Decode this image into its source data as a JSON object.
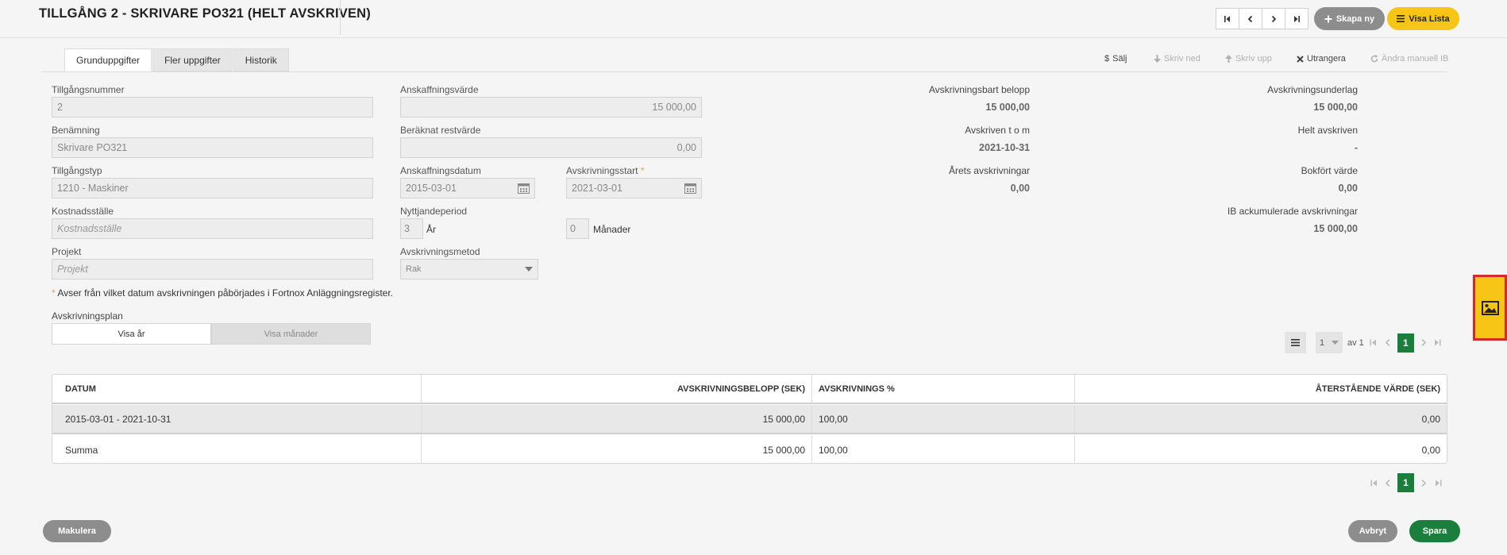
{
  "header": {
    "title": "TILLGÅNG 2 - SKRIVARE PO321 (HELT AVSKRIVEN)",
    "create_label": "Skapa ny",
    "list_label": "Visa Lista"
  },
  "tabs": [
    {
      "label": "Grunduppgifter",
      "active": true
    },
    {
      "label": "Fler uppgifter",
      "active": false
    },
    {
      "label": "Historik",
      "active": false
    }
  ],
  "actions": {
    "sell": "Sälj",
    "write_down": "Skriv ned",
    "write_up": "Skriv upp",
    "scrap": "Utrangera",
    "change_ib": "Ändra manuell IB"
  },
  "form": {
    "asset_number_label": "Tillgångsnummer",
    "asset_number": "2",
    "name_label": "Benämning",
    "name": "Skrivare PO321",
    "asset_type_label": "Tillgångstyp",
    "asset_type": "1210 - Maskiner",
    "cost_center_label": "Kostnadsställe",
    "cost_center_placeholder": "Kostnadsställe",
    "project_label": "Projekt",
    "project_placeholder": "Projekt",
    "acquisition_value_label": "Anskaffningsvärde",
    "acquisition_value": "15 000,00",
    "residual_value_label": "Beräknat restvärde",
    "residual_value": "0,00",
    "acquisition_date_label": "Anskaffningsdatum",
    "acquisition_date": "2015-03-01",
    "depreciation_start_label": "Avskrivningsstart",
    "depreciation_start_required": "*",
    "depreciation_start": "2021-03-01",
    "useful_life_label": "Nyttjandeperiod",
    "useful_life_years": "3",
    "years_unit": "År",
    "useful_life_months": "0",
    "months_unit": "Månader",
    "method_label": "Avskrivningsmetod",
    "method": "Rak",
    "note_star": "*",
    "note": "Avser från vilket datum avskrivningen påbörjades i Fortnox Anläggningsregister."
  },
  "summary": {
    "depreciable_amount_label": "Avskrivningsbart belopp",
    "depreciable_amount": "15 000,00",
    "depreciation_basis_label": "Avskrivningsunderlag",
    "depreciation_basis": "15 000,00",
    "depreciated_until_label": "Avskriven t o m",
    "depreciated_until": "2021-10-31",
    "fully_depreciated_label": "Helt avskriven",
    "fully_depreciated": "-",
    "year_depreciations_label": "Årets avskrivningar",
    "year_depreciations": "0,00",
    "book_value_label": "Bokfört värde",
    "book_value": "0,00",
    "ib_accumulated_label": "IB ackumulerade avskrivningar",
    "ib_accumulated": "15 000,00"
  },
  "plan": {
    "label": "Avskrivningsplan",
    "show_years": "Visa år",
    "show_months": "Visa månader"
  },
  "pager": {
    "page_size": "1",
    "of_label": "av 1",
    "current": "1"
  },
  "table": {
    "headers": [
      "DATUM",
      "AVSKRIVNINGSBELOPP (SEK)",
      "AVSKRIVNINGS %",
      "ÅTERSTÅENDE VÄRDE (SEK)"
    ],
    "rows": [
      [
        "2015-03-01 - 2021-10-31",
        "15 000,00",
        "100,00",
        "0,00"
      ]
    ],
    "total": [
      "Summa",
      "15 000,00",
      "100,00",
      "0,00"
    ]
  },
  "footer": {
    "void_label": "Makulera",
    "cancel_label": "Avbryt",
    "save_label": "Spara"
  },
  "colors": {
    "accent_yellow": "#f7c515",
    "accent_green": "#1a7f3c",
    "gray_button": "#8d8d8d"
  }
}
